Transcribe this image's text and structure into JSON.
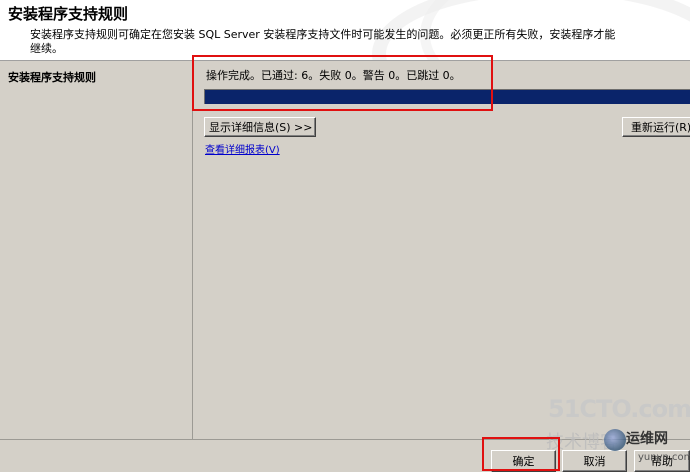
{
  "header": {
    "title": "安装程序支持规则",
    "description": "安装程序支持规则可确定在您安装 SQL Server 安装程序支持文件时可能发生的问题。必须更正所有失败，安装程序才能继续。"
  },
  "sidebar": {
    "items": [
      {
        "label": "安装程序支持规则"
      }
    ]
  },
  "main": {
    "status_text": "操作完成。已通过: 6。失败 0。警告 0。已跳过 0。",
    "progress_fraction": 1.0,
    "show_details_label": "显示详细信息(S) >>",
    "rerun_label": "重新运行(R)",
    "view_report_label": "查看详细报表(V)"
  },
  "footer": {
    "ok_label": "确定",
    "cancel_label": "取消",
    "help_label": "帮助"
  },
  "watermark": {
    "site": "51CTO.com",
    "blog": "技术博客",
    "brand": "运维网",
    "url": "yunvn.com"
  },
  "colors": {
    "progress_fill": "#0a246a",
    "highlight_red": "#e01010",
    "link": "#0000cc"
  }
}
